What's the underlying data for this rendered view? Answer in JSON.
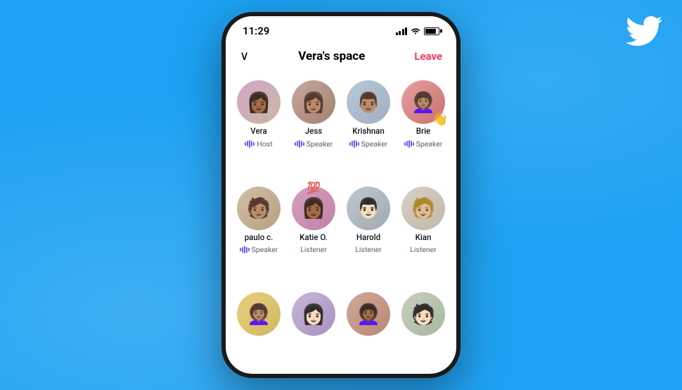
{
  "background": {
    "color": "#1DA1F2"
  },
  "twitter_logo": {
    "alt": "Twitter bird logo"
  },
  "phone": {
    "status_bar": {
      "time": "11:29"
    },
    "header": {
      "title": "Vera's space",
      "leave_label": "Leave",
      "chevron": "∨"
    },
    "participants": [
      {
        "name": "Vera",
        "role": "Host",
        "role_type": "host",
        "avatar_class": "avatar-vera",
        "emoji": "👩🏾"
      },
      {
        "name": "Jess",
        "role": "Speaker",
        "role_type": "speaker",
        "avatar_class": "avatar-jess",
        "emoji": "👩🏽"
      },
      {
        "name": "Krishnan",
        "role": "Speaker",
        "role_type": "speaker",
        "avatar_class": "avatar-krishnan",
        "emoji": "👨🏽"
      },
      {
        "name": "Brie",
        "role": "Speaker",
        "role_type": "speaker",
        "avatar_class": "avatar-brie",
        "has_wave": true,
        "emoji": "👩🏽‍🦱"
      },
      {
        "name": "paulo c.",
        "role": "Speaker",
        "role_type": "speaker",
        "avatar_class": "avatar-paulo",
        "emoji": "🧑🏽"
      },
      {
        "name": "Katie O.",
        "role": "Listener",
        "role_type": "listener",
        "avatar_class": "avatar-katie",
        "emoji": "👩🏾"
      },
      {
        "name": "Harold",
        "role": "Listener",
        "role_type": "listener",
        "avatar_class": "avatar-harold",
        "emoji": "👨🏻"
      },
      {
        "name": "Kian",
        "role": "Listener",
        "role_type": "listener",
        "avatar_class": "avatar-kian",
        "emoji": "🧑🏼"
      },
      {
        "name": "",
        "role": "",
        "role_type": "listener",
        "avatar_class": "avatar-row3a",
        "emoji": "👩🏽‍🦱"
      },
      {
        "name": "",
        "role": "",
        "role_type": "listener",
        "avatar_class": "avatar-row3b",
        "emoji": "👩🏻"
      },
      {
        "name": "",
        "role": "",
        "role_type": "listener",
        "avatar_class": "avatar-row3c",
        "emoji": "👩🏾‍🦱"
      },
      {
        "name": "",
        "role": "",
        "role_type": "listener",
        "avatar_class": "avatar-row3d",
        "emoji": "🧑🏻"
      }
    ]
  }
}
